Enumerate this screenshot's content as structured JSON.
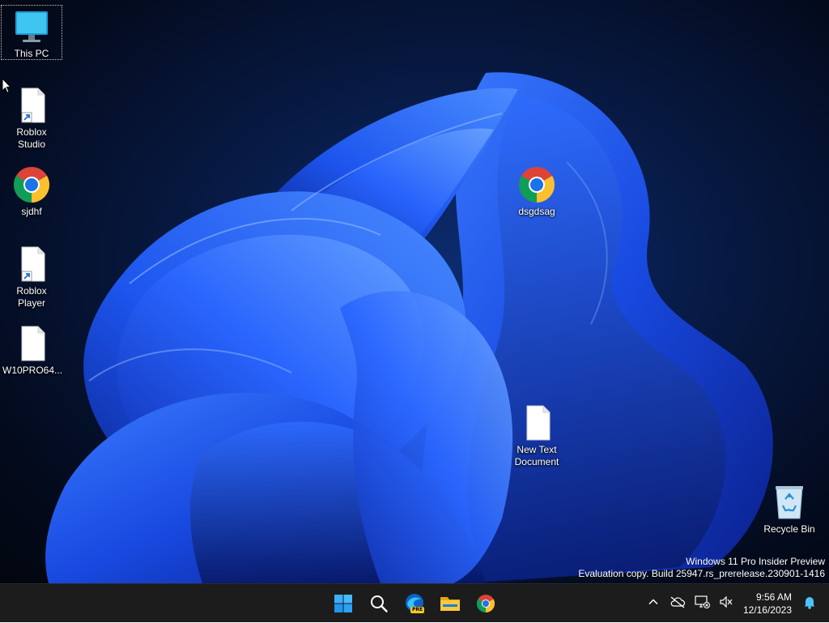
{
  "desktop": {
    "icons": [
      {
        "label": "This PC",
        "icon": "monitor-icon"
      },
      {
        "label": "Roblox Studio",
        "icon": "shortcut-file-icon"
      },
      {
        "label": "sjdhf",
        "icon": "chrome-icon"
      },
      {
        "label": "Roblox Player",
        "icon": "shortcut-file-icon"
      },
      {
        "label": "W10PRO64...",
        "icon": "file-icon"
      },
      {
        "label": "dsgdsag",
        "icon": "chrome-icon"
      },
      {
        "label": "New Text Document",
        "icon": "text-file-icon"
      },
      {
        "label": "Recycle Bin",
        "icon": "recycle-bin-icon"
      }
    ]
  },
  "watermark": {
    "line1": "Windows 11 Pro Insider Preview",
    "line2": "Evaluation copy. Build 25947.rs_prerelease.230901-1416"
  },
  "taskbar": {
    "apps": [
      {
        "name": "Start",
        "icon": "windows-start-icon"
      },
      {
        "name": "Search",
        "icon": "search-icon"
      },
      {
        "name": "Microsoft Edge Preview",
        "icon": "edge-pre-icon",
        "badge": "PRE"
      },
      {
        "name": "File Explorer",
        "icon": "folder-icon"
      },
      {
        "name": "Google Chrome",
        "icon": "chrome-icon"
      }
    ],
    "tray": {
      "time": "9:56 AM",
      "date": "12/16/2023"
    }
  },
  "colors": {
    "taskbar": "#1c1c1c",
    "accent": "#0078d4",
    "wallpaper_blue": "#1a4fe0"
  }
}
